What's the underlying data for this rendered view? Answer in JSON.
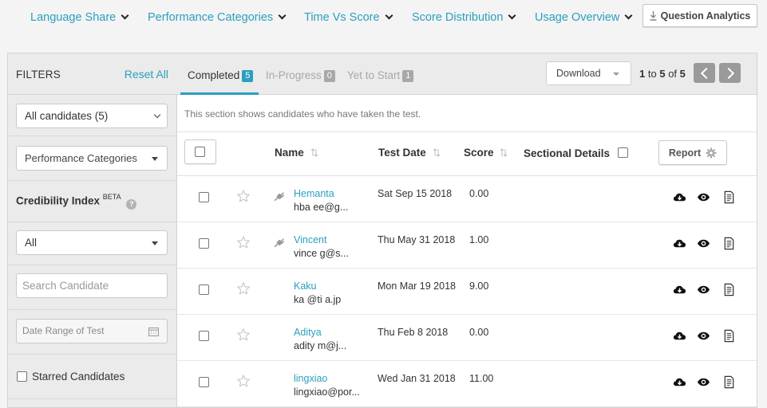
{
  "nav": {
    "items": [
      {
        "label": "Language Share"
      },
      {
        "label": "Performance Categories"
      },
      {
        "label": "Time Vs Score"
      },
      {
        "label": "Score Distribution"
      },
      {
        "label": "Usage Overview"
      }
    ],
    "question_analytics": "Question Analytics"
  },
  "filters": {
    "title": "FILTERS",
    "reset_all": "Reset All",
    "candidates_select": "All candidates (5)",
    "performance_select": "Performance Categories",
    "credibility_label": "Credibility Index",
    "credibility_beta": "BETA",
    "credibility_select": "All",
    "search_placeholder": "Search Candidate",
    "date_placeholder": "Date Range of Test",
    "starred_label": "Starred Candidates"
  },
  "tabs": [
    {
      "label": "Completed",
      "count": "5"
    },
    {
      "label": "In-Progress",
      "count": "0"
    },
    {
      "label": "Yet to Start",
      "count": "1"
    }
  ],
  "toolbar": {
    "download_label": "Download",
    "pager_from": "1",
    "pager_to_word": "to",
    "pager_to": "5",
    "pager_of_word": "of",
    "pager_total": "5"
  },
  "section_info": "This section shows candidates who have taken the test.",
  "table": {
    "headers": {
      "name": "Name",
      "test_date": "Test Date",
      "score": "Score",
      "sectional": "Sectional Details",
      "report": "Report"
    },
    "rows": [
      {
        "name": "Hemanta",
        "email": "hba       ee@g...",
        "date": "Sat Sep 15 2018",
        "score": "0.00",
        "plug": true
      },
      {
        "name": "Vincent",
        "email": "vince     g@s...",
        "date": "Thu May 31 2018",
        "score": "1.00",
        "plug": true
      },
      {
        "name": "Kaku",
        "email": "ka     @ti     a.jp",
        "date": "Mon Mar 19 2018",
        "score": "9.00",
        "plug": false
      },
      {
        "name": "Aditya",
        "email": "adity      m@j...",
        "date": "Thu Feb 8 2018",
        "score": "0.00",
        "plug": false
      },
      {
        "name": "lingxiao",
        "email": "lingxiao@por...",
        "date": "Wed Jan 31 2018",
        "score": "11.00",
        "plug": false
      }
    ]
  },
  "colors": {
    "accent": "#2a9fbf",
    "inactive_badge": "#a8a8a8",
    "sidebar_bg": "#ebebeb"
  },
  "icons": [
    "chevron-down-icon",
    "download-arrow-icon",
    "info-icon",
    "calendar-icon",
    "sort-icon",
    "gear-icon",
    "star-icon",
    "plug-icon",
    "cloud-download-icon",
    "eye-icon",
    "document-icon"
  ]
}
